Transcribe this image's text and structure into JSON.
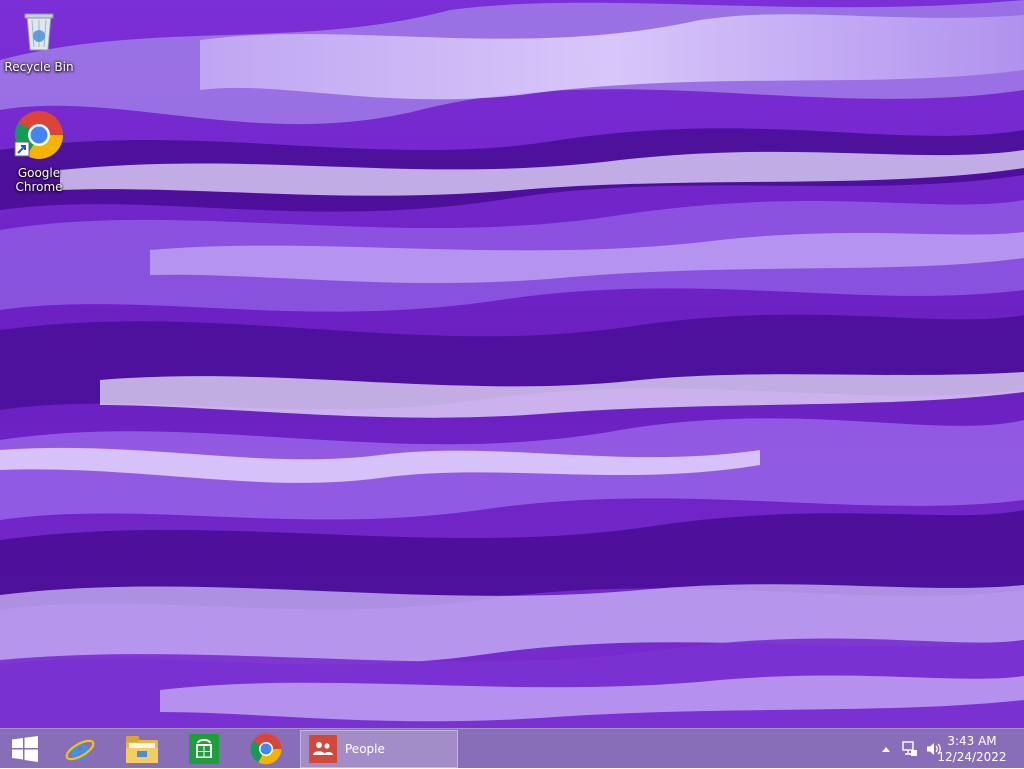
{
  "desktop": {
    "icons": [
      {
        "label": "Recycle Bin",
        "icon": "recycle-bin-icon"
      },
      {
        "label": "Google Chrome",
        "icon": "chrome-icon"
      }
    ]
  },
  "taskbar": {
    "start_icon": "windows-logo-icon",
    "pinned": [
      {
        "icon": "internet-explorer-icon"
      },
      {
        "icon": "file-explorer-icon"
      },
      {
        "icon": "store-icon"
      },
      {
        "icon": "chrome-icon"
      }
    ],
    "open_window": {
      "label": "People",
      "icon": "people-icon"
    },
    "tray": {
      "icons": [
        "show-hidden-icons-chevron",
        "network-icon",
        "volume-icon"
      ],
      "time": "3:43 AM",
      "date": "12/24/2022"
    }
  },
  "colors": {
    "wallpaper_base": "#6a1fc0",
    "taskbar": "#785aaf",
    "people_tile": "#d2493a"
  }
}
